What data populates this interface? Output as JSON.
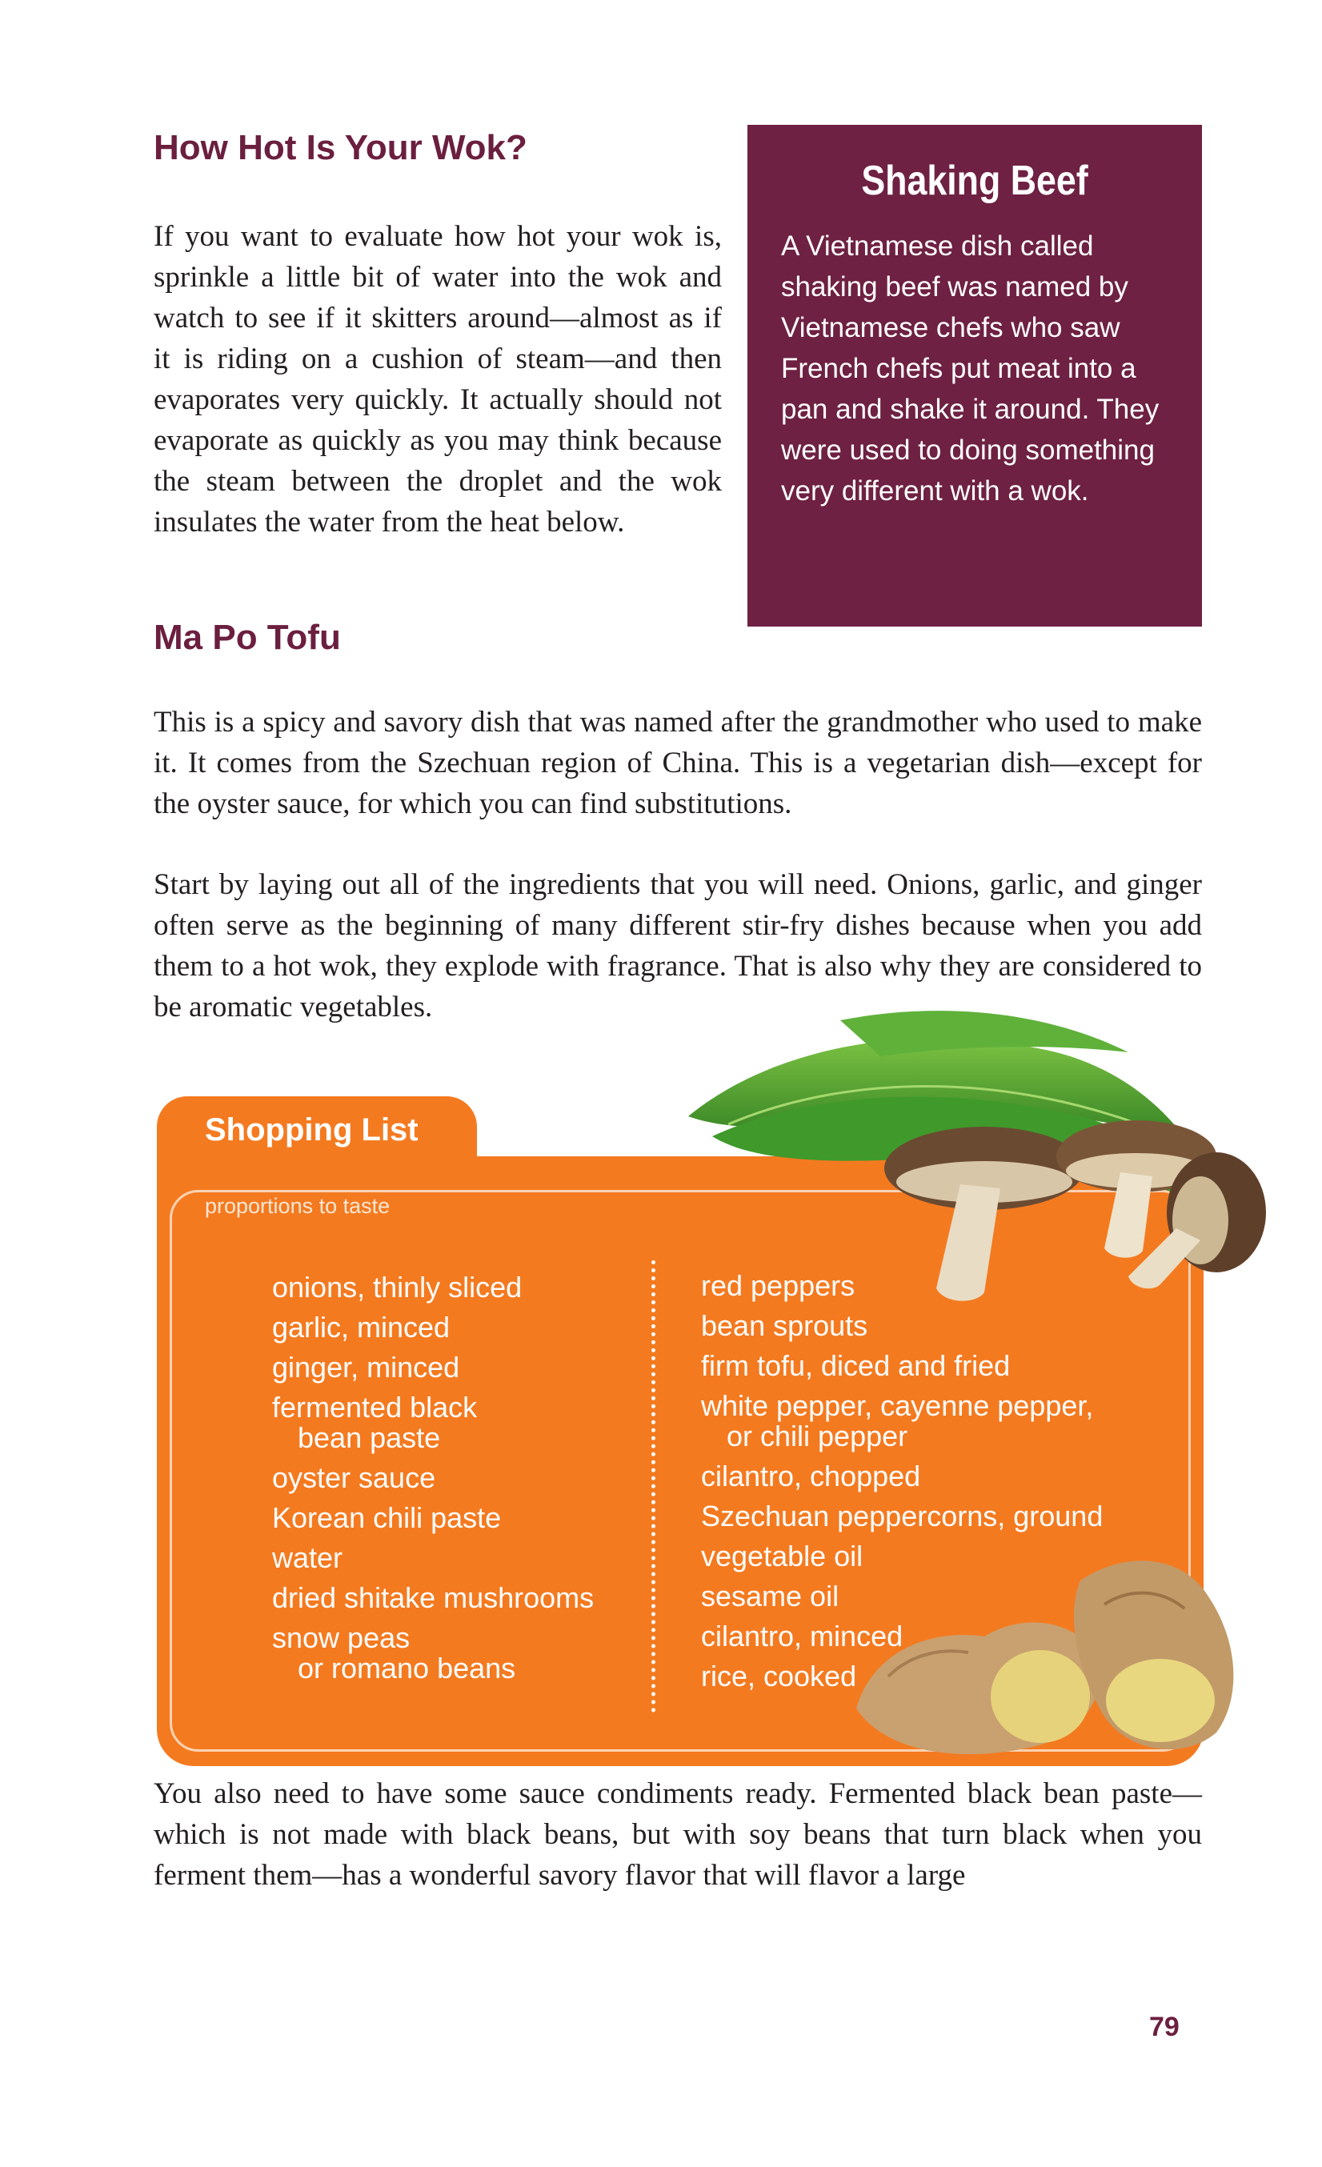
{
  "article": {
    "heading1": "How Hot Is Your Wok?",
    "para1": "If you want to evaluate how hot your wok is, sprinkle a little bit of water into the wok and watch to see if it skitters around—almost as if it is riding on a cushion of steam—and then evaporates very quickly. It actually should not evaporate as quickly as you may think because the steam between the droplet and the wok insulates the water from the heat below.",
    "heading2": "Ma Po Tofu",
    "para2": "This is a spicy and savory dish that was named after the grandmother who used to make it. It comes from the Szechuan region of China. This is a vegetarian dish—except for the oyster sauce, for which you can find substitutions.",
    "para3": "Start by laying out all of the ingredients that you will need. Onions, garlic, and ginger often serve as the beginning of many different stir-fry dishes because when you add them to a hot wok, they explode with fragrance. That is also why they are considered to be aromatic vegetables.",
    "para4": "You also need to have some sauce condiments ready. Fermented black bean paste—which is not made with black beans, but with soy beans that turn black when you ferment them—has a wonderful savory flavor that will flavor a large"
  },
  "sidebar": {
    "title": "Shaking Beef",
    "body": "A Vietnamese dish called shaking beef was named by Vietnamese chefs who saw French chefs put meat into a pan and shake it around. They were used to doing something very different with a wok."
  },
  "shopping_list": {
    "title": "Shopping List",
    "note": "proportions to taste",
    "left": [
      {
        "line1": "onions, thinly sliced",
        "line2": ""
      },
      {
        "line1": "garlic, minced",
        "line2": ""
      },
      {
        "line1": "ginger, minced",
        "line2": ""
      },
      {
        "line1": "fermented black",
        "line2": "bean paste"
      },
      {
        "line1": "oyster sauce",
        "line2": ""
      },
      {
        "line1": "Korean chili paste",
        "line2": ""
      },
      {
        "line1": "water",
        "line2": ""
      },
      {
        "line1": "dried shitake mushrooms",
        "line2": ""
      },
      {
        "line1": "snow peas",
        "line2": "or romano beans"
      }
    ],
    "right": [
      {
        "line1": "red peppers",
        "line2": ""
      },
      {
        "line1": "bean sprouts",
        "line2": ""
      },
      {
        "line1": "firm tofu, diced and fried",
        "line2": ""
      },
      {
        "line1": "white pepper, cayenne pepper,",
        "line2": "or chili pepper"
      },
      {
        "line1": "cilantro, chopped",
        "line2": ""
      },
      {
        "line1": "Szechuan peppercorns, ground",
        "line2": ""
      },
      {
        "line1": "vegetable oil",
        "line2": ""
      },
      {
        "line1": "sesame oil",
        "line2": ""
      },
      {
        "line1": "cilantro, minced",
        "line2": ""
      },
      {
        "line1": "rice, cooked",
        "line2": ""
      }
    ]
  },
  "page_number": "79",
  "colors": {
    "heading": "#6b1f3f",
    "sidebar_bg": "#6e2142",
    "shopping_bg": "#f47a20"
  },
  "images": [
    "snow-peas",
    "mushrooms",
    "ginger-root"
  ]
}
